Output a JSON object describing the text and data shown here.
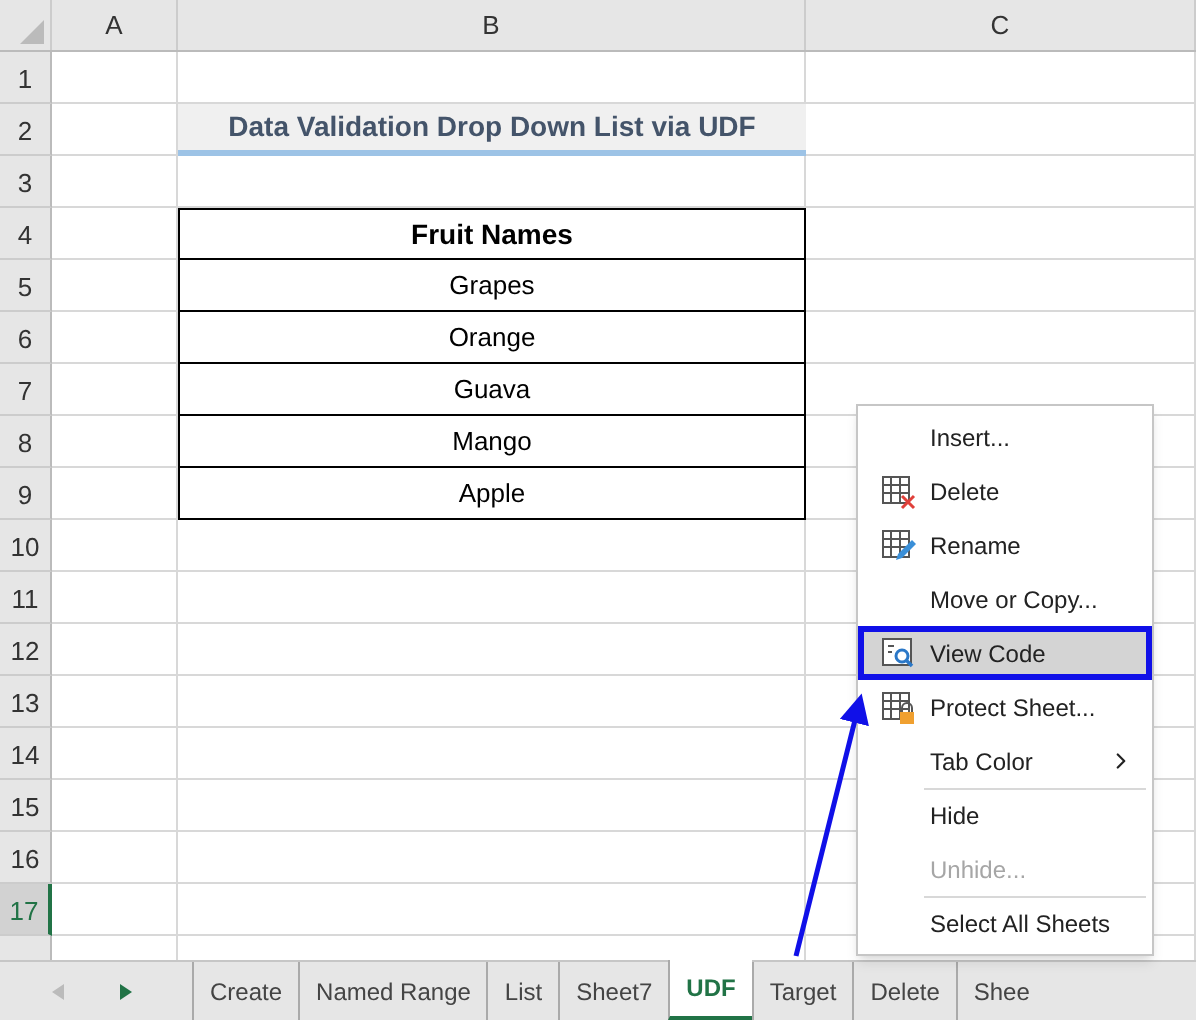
{
  "sheet": {
    "columns": [
      "A",
      "B",
      "C"
    ],
    "rows": [
      {
        "number": "1",
        "selected": false
      },
      {
        "number": "2",
        "selected": false
      },
      {
        "number": "3",
        "selected": false
      },
      {
        "number": "4",
        "selected": false
      },
      {
        "number": "5",
        "selected": false
      },
      {
        "number": "6",
        "selected": false
      },
      {
        "number": "7",
        "selected": false
      },
      {
        "number": "8",
        "selected": false
      },
      {
        "number": "9",
        "selected": false
      },
      {
        "number": "10",
        "selected": false
      },
      {
        "number": "11",
        "selected": false
      },
      {
        "number": "12",
        "selected": false
      },
      {
        "number": "13",
        "selected": false
      },
      {
        "number": "14",
        "selected": false
      },
      {
        "number": "15",
        "selected": false
      },
      {
        "number": "16",
        "selected": false
      },
      {
        "number": "17",
        "selected": true
      }
    ],
    "title": "Data Validation Drop Down List via UDF",
    "table": {
      "header": "Fruit Names",
      "items": [
        "Grapes",
        "Orange",
        "Guava",
        "Mango",
        "Apple"
      ]
    }
  },
  "context_menu": [
    {
      "label": "Insert...",
      "kind": "plain",
      "highlighted": false,
      "disabled": false,
      "submenu": false,
      "separator_before": false
    },
    {
      "label": "Delete",
      "kind": "delete",
      "highlighted": false,
      "disabled": false,
      "submenu": false,
      "separator_before": false
    },
    {
      "label": "Rename",
      "kind": "rename",
      "highlighted": false,
      "disabled": false,
      "submenu": false,
      "separator_before": false
    },
    {
      "label": "Move or Copy...",
      "kind": "plain",
      "highlighted": false,
      "disabled": false,
      "submenu": false,
      "separator_before": false
    },
    {
      "label": "View Code",
      "kind": "code",
      "highlighted": true,
      "disabled": false,
      "submenu": false,
      "separator_before": false
    },
    {
      "label": "Protect Sheet...",
      "kind": "protect",
      "highlighted": false,
      "disabled": false,
      "submenu": false,
      "separator_before": false
    },
    {
      "label": "Tab Color",
      "kind": "plain",
      "highlighted": false,
      "disabled": false,
      "submenu": true,
      "separator_before": false
    },
    {
      "label": "Hide",
      "kind": "plain",
      "highlighted": false,
      "disabled": false,
      "submenu": false,
      "separator_before": true
    },
    {
      "label": "Unhide...",
      "kind": "plain",
      "highlighted": false,
      "disabled": true,
      "submenu": false,
      "separator_before": false
    },
    {
      "label": "Select All Sheets",
      "kind": "plain",
      "highlighted": false,
      "disabled": false,
      "submenu": false,
      "separator_before": true
    }
  ],
  "sheet_tabs": [
    {
      "label": "Create",
      "selected": false
    },
    {
      "label": "Named Range",
      "selected": false
    },
    {
      "label": "List",
      "selected": false
    },
    {
      "label": "Sheet7",
      "selected": false
    },
    {
      "label": "UDF",
      "selected": true
    },
    {
      "label": "Target",
      "selected": false
    },
    {
      "label": "Delete",
      "selected": false
    },
    {
      "label": "Shee",
      "selected": false
    }
  ]
}
